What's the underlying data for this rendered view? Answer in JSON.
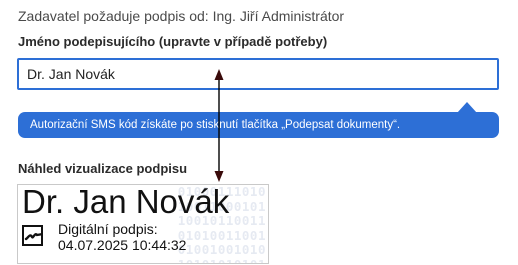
{
  "form": {
    "requester_text": "Zadavatel požaduje podpis od: Ing. Jiří Administrátor",
    "signer_name_label": "Jméno podepisujícího (upravte v případě potřeby)",
    "signer_name_value": "Dr. Jan Novák"
  },
  "tooltip": {
    "text": "Autorizační SMS kód získáte po stisknutí tlačítka „Podepsat dokumenty“."
  },
  "preview": {
    "label": "Náhled vizualizace podpisu",
    "signature_name": "Dr. Jan Novák",
    "signature_caption": "Digitální podpis:",
    "signature_date": "04.07.2025 10:44:32",
    "check_icon": "signature-check-icon"
  },
  "annotation": {
    "icon": "double-headed-arrow",
    "color": "#000000"
  },
  "colors": {
    "accent": "#2d6fd6",
    "text": "#333333",
    "watermark": "#e6eaf2"
  }
}
